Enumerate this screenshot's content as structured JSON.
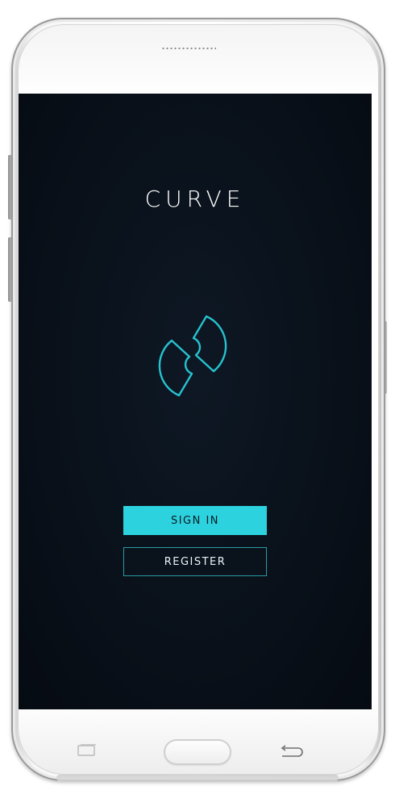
{
  "app": {
    "brand": "CURVE",
    "logo_icon": "curve-logo-icon",
    "accent_color": "#2cd3de",
    "background_color": "#0a121c"
  },
  "actions": {
    "sign_in_label": "SIGN IN",
    "register_label": "REGISTER"
  },
  "device": {
    "home_button_icon": "home-button-icon",
    "recent_apps_icon": "recent-apps-icon",
    "back_icon": "back-arrow-icon"
  }
}
